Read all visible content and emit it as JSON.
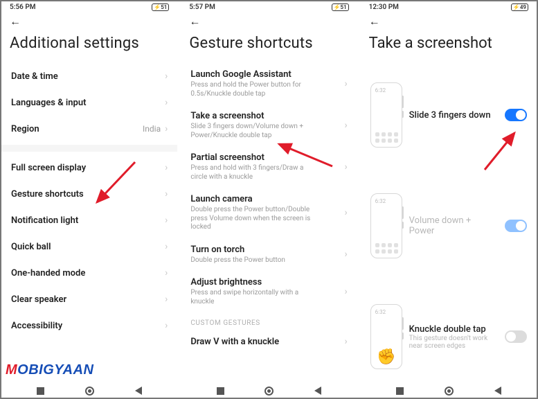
{
  "panels": [
    {
      "status": {
        "time": "5:56 PM",
        "battery": "51"
      },
      "title": "Additional settings",
      "rows": [
        {
          "label": "Date & time",
          "value": "",
          "type": "nav"
        },
        {
          "label": "Languages & input",
          "value": "",
          "type": "nav"
        },
        {
          "label": "Region",
          "value": "India",
          "type": "nav"
        },
        {
          "type": "divider"
        },
        {
          "label": "Full screen display",
          "value": "",
          "type": "nav"
        },
        {
          "label": "Gesture shortcuts",
          "value": "",
          "type": "nav"
        },
        {
          "label": "Notification light",
          "value": "",
          "type": "nav"
        },
        {
          "label": "Quick ball",
          "value": "",
          "type": "nav"
        },
        {
          "label": "One-handed mode",
          "value": "",
          "type": "nav"
        },
        {
          "label": "Clear speaker",
          "value": "",
          "type": "nav"
        },
        {
          "label": "Accessibility",
          "value": "",
          "type": "nav"
        }
      ]
    },
    {
      "status": {
        "time": "5:57 PM",
        "battery": "51"
      },
      "title": "Gesture shortcuts",
      "rows": [
        {
          "label": "Launch Google Assistant",
          "sub": "Press and hold the Power button for 0.5s/Knuckle double tap",
          "type": "navsub"
        },
        {
          "label": "Take a screenshot",
          "sub": "Slide 3 fingers down/Volume down + Power/Knuckle double tap",
          "type": "navsub"
        },
        {
          "label": "Partial screenshot",
          "sub": "Press and hold with 3 fingers/Draw a circle with a knuckle",
          "type": "navsub"
        },
        {
          "label": "Launch camera",
          "sub": "Double press the Power button/Double press Volume down when the screen is locked",
          "type": "navsub"
        },
        {
          "label": "Turn on torch",
          "sub": "Double press the Power button",
          "type": "navsub"
        },
        {
          "label": "Adjust brightness",
          "sub": "Press and swipe horizontally with a knuckle",
          "type": "navsub"
        },
        {
          "type": "section",
          "label": "CUSTOM GESTURES"
        },
        {
          "label": "Draw V with a knuckle",
          "value": "",
          "type": "nav"
        }
      ]
    },
    {
      "status": {
        "time": "12:30 PM",
        "battery": "49"
      },
      "title": "Take a screenshot",
      "toggles": [
        {
          "label": "Slide 3 fingers down",
          "mock_time": "6:32",
          "state": "on",
          "dim": false
        },
        {
          "label": "Volume down + Power",
          "mock_time": "6:32",
          "state": "on",
          "dim": true
        },
        {
          "label": "Knuckle double tap",
          "sub": "This gesture doesn't work near screen edges",
          "mock_time": "6:32",
          "state": "off",
          "dim": true,
          "hand": true
        }
      ]
    }
  ],
  "watermark": {
    "m": "M",
    "rest": "OBIGYAAN"
  }
}
